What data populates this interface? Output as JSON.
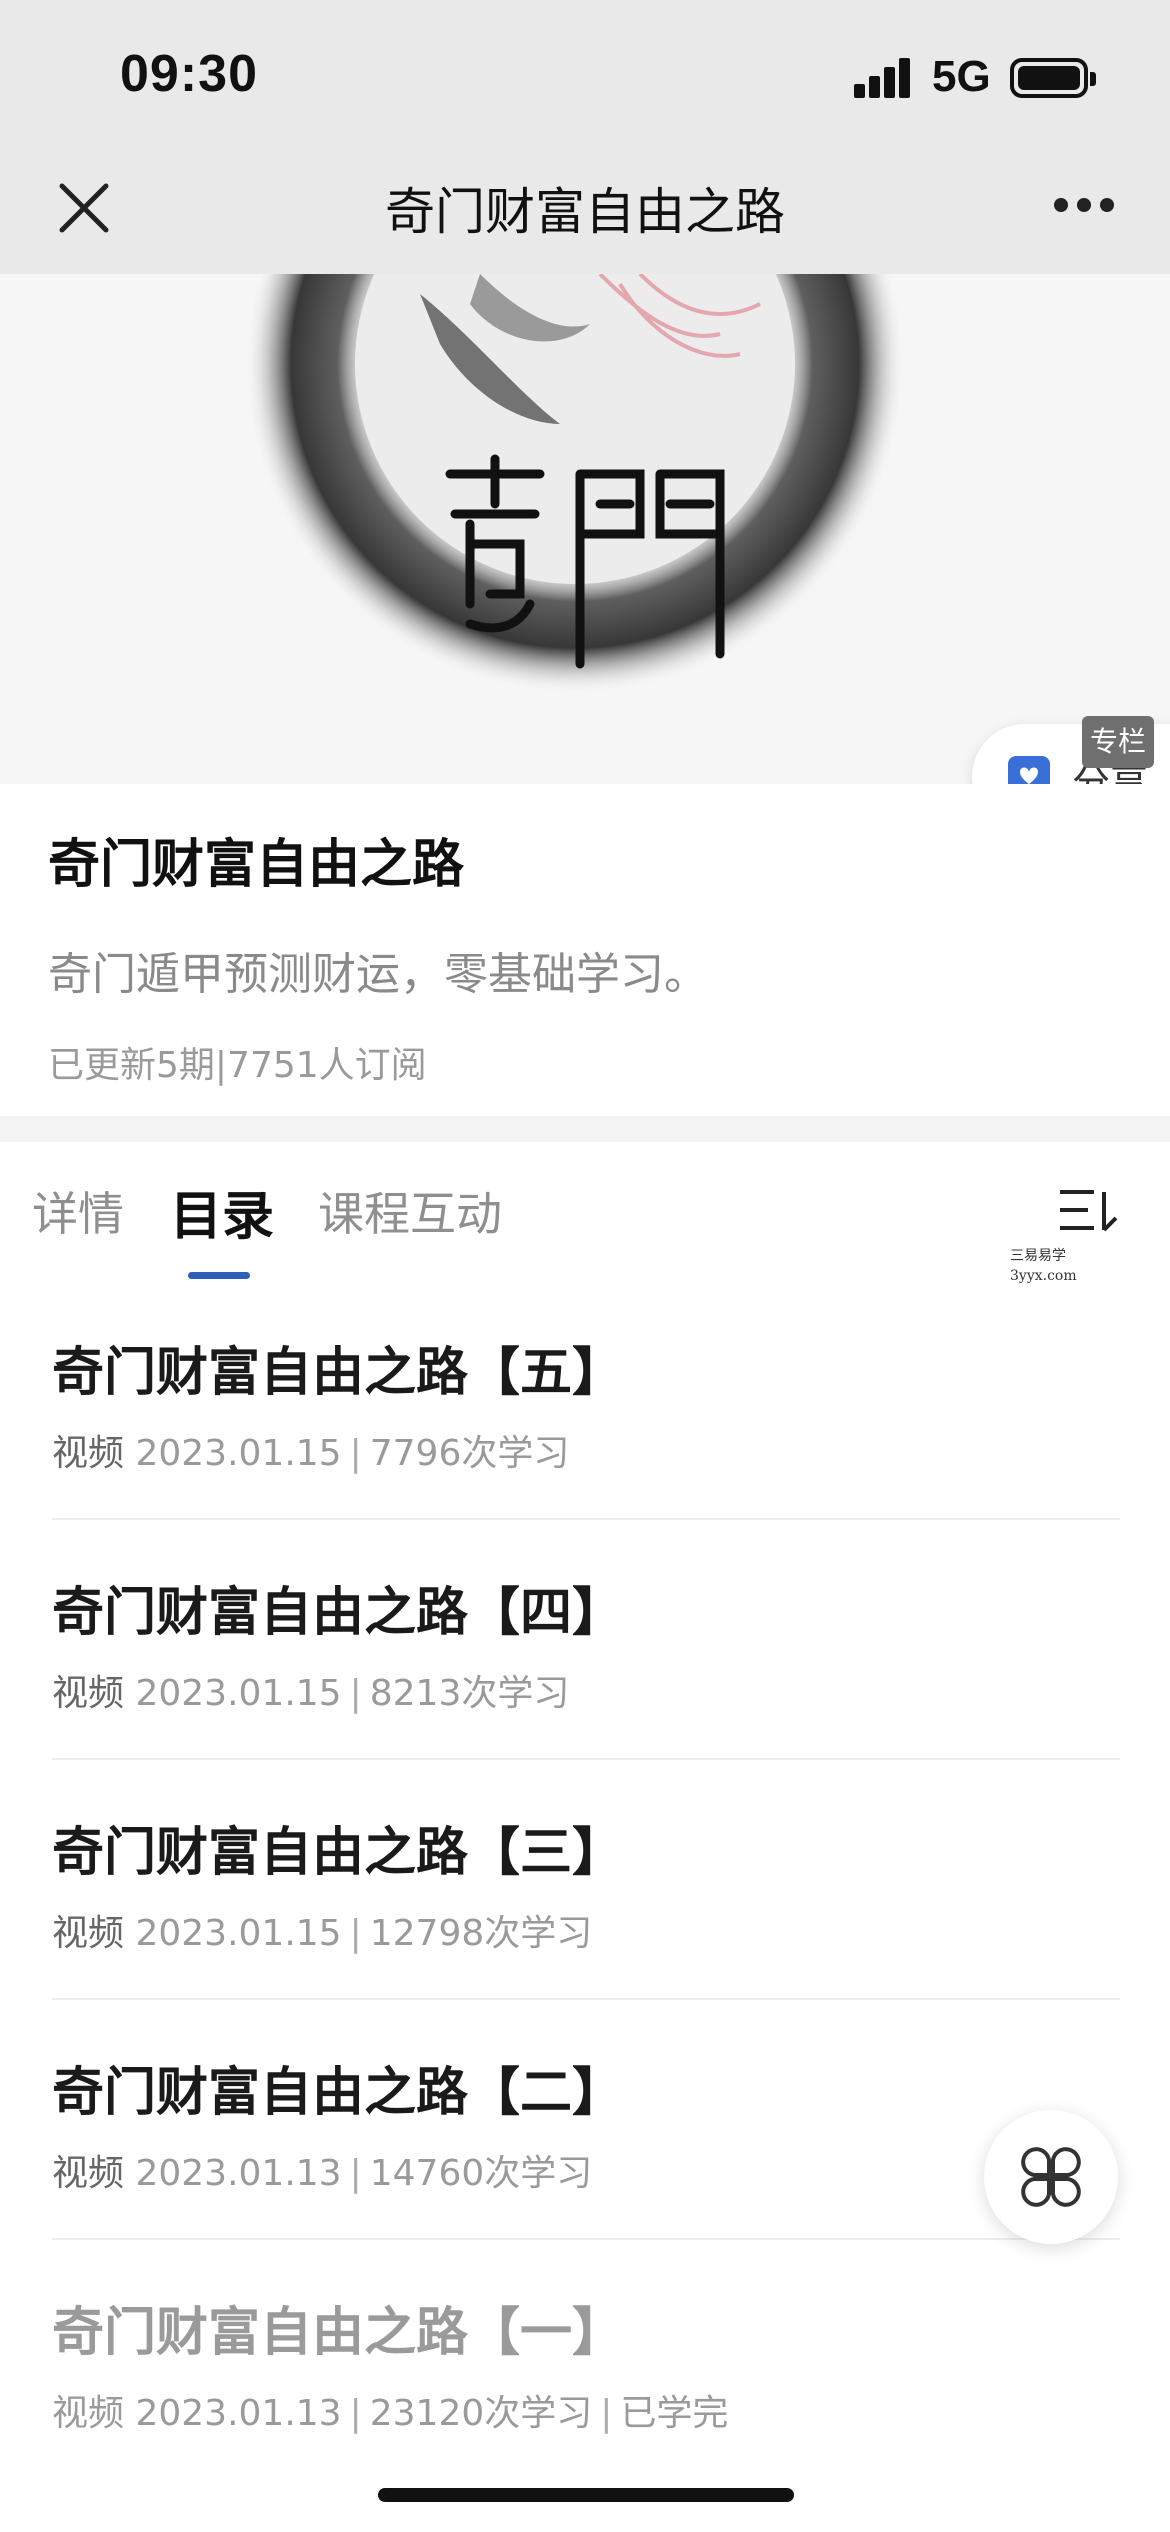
{
  "status_bar": {
    "time": "09:30",
    "network": "5G",
    "icons": [
      "signal-icon",
      "battery-icon"
    ]
  },
  "nav": {
    "title": "奇门财富自由之路",
    "close_icon": "close-icon",
    "more_icon": "more-icon"
  },
  "banner": {
    "share_label": "分享",
    "badge": "专栏"
  },
  "course": {
    "title": "奇门财富自由之路",
    "description": "奇门遁甲预测财运，零基础学习。",
    "meta": "已更新5期|7751人订阅"
  },
  "tabs": [
    {
      "label": "详情",
      "active": false
    },
    {
      "label": "目录",
      "active": true
    },
    {
      "label": "课程互动",
      "active": false
    }
  ],
  "watermark": {
    "line1": "三易易学",
    "line2": "3yyx.com"
  },
  "episodes": [
    {
      "title": "奇门财富自由之路【五】",
      "type": "视频",
      "date": "2023.01.15",
      "views": "7796次学习",
      "status": ""
    },
    {
      "title": "奇门财富自由之路【四】",
      "type": "视频",
      "date": "2023.01.15",
      "views": "8213次学习",
      "status": ""
    },
    {
      "title": "奇门财富自由之路【三】",
      "type": "视频",
      "date": "2023.01.15",
      "views": "12798次学习",
      "status": ""
    },
    {
      "title": "奇门财富自由之路【二】",
      "type": "视频",
      "date": "2023.01.13",
      "views": "14760次学习",
      "status": ""
    },
    {
      "title": "奇门财富自由之路【一】",
      "type": "视频",
      "date": "2023.01.13",
      "views": "23120次学习",
      "status": "已学完"
    }
  ],
  "colors": {
    "accent": "#2b5fb8",
    "header_bg": "#e9e9e9",
    "muted_text": "#9a9a9a"
  }
}
